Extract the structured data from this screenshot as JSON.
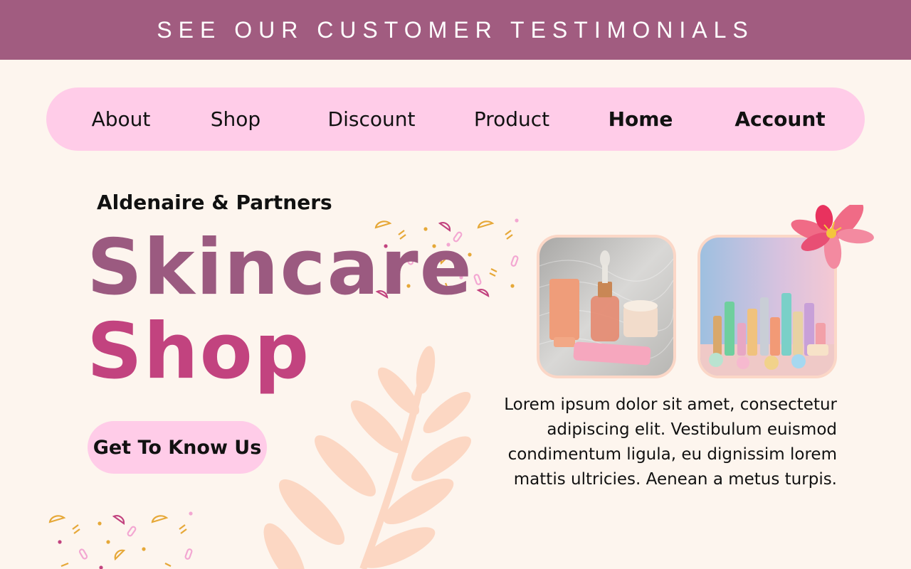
{
  "banner": {
    "text": "SEE OUR CUSTOMER TESTIMONIALS"
  },
  "nav": {
    "items": [
      {
        "label": "About"
      },
      {
        "label": "Shop"
      },
      {
        "label": "Discount"
      },
      {
        "label": "Product"
      },
      {
        "label": "Home"
      },
      {
        "label": "Account"
      }
    ]
  },
  "hero": {
    "brand": "Aldenaire & Partners",
    "title_line1": "Skincare",
    "title_line2": "Shop",
    "cta_label": "Get To Know Us",
    "description": "Lorem ipsum dolor sit amet, consectetur adipiscing elit. Vestibulum euismod condimentum ligula, eu dignissim lorem mattis ultricies. Aenean a metus turpis."
  },
  "colors": {
    "banner": "#a15c80",
    "nav_bg": "#ffcce8",
    "page_bg": "#fdf5ee",
    "title_top": "#9b5a80",
    "title_bottom": "#c2437f",
    "leaf": "#fcd7c3",
    "flower": "#f06b86"
  },
  "icons": {
    "flower": "flower-icon",
    "leaf": "leaf-branch-icon",
    "confetti": "confetti-decoration"
  }
}
